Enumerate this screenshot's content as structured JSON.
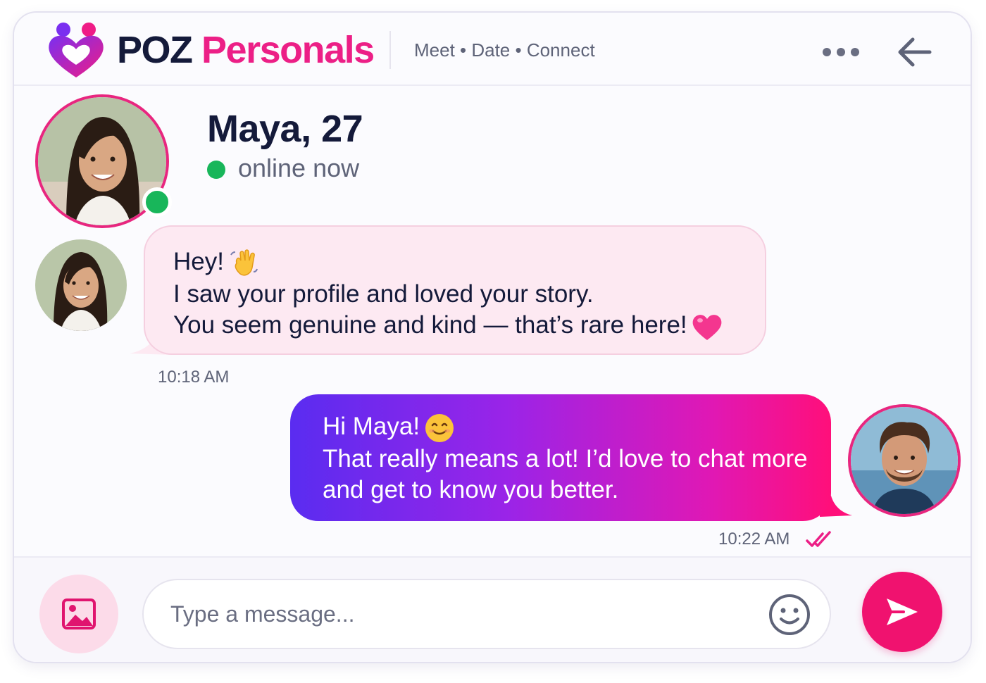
{
  "app": {
    "brand_part1": "POZ",
    "brand_part2": "Personals",
    "tagline": "Meet • Date • Connect",
    "brand_color": "#ec1f86",
    "accent_color": "#f0126f"
  },
  "header": {
    "more_icon": "more-dots-icon",
    "back_icon": "arrow-left-icon"
  },
  "contact": {
    "name": "Maya, 27",
    "status": "online now",
    "status_color": "#18b65a"
  },
  "messages": [
    {
      "direction": "incoming",
      "lines": [
        "Hey!",
        "I saw your profile and loved your story.",
        "You seem genuine and kind — that’s rare here!"
      ],
      "emojis": [
        "waving-hand-emoji",
        "pink-heart-emoji"
      ],
      "time": "10:18 AM"
    },
    {
      "direction": "outgoing",
      "lines": [
        "Hi Maya!",
        "That really means a lot! I’d love to chat more",
        "and get to know you better."
      ],
      "emojis": [
        "smiling-face-emoji"
      ],
      "time": "10:22 AM",
      "read_icon": "double-check-icon"
    }
  ],
  "composer": {
    "placeholder": "Type a message...",
    "value": "",
    "media_icon": "image-icon",
    "emoji_icon": "smiley-icon",
    "send_icon": "send-icon"
  }
}
